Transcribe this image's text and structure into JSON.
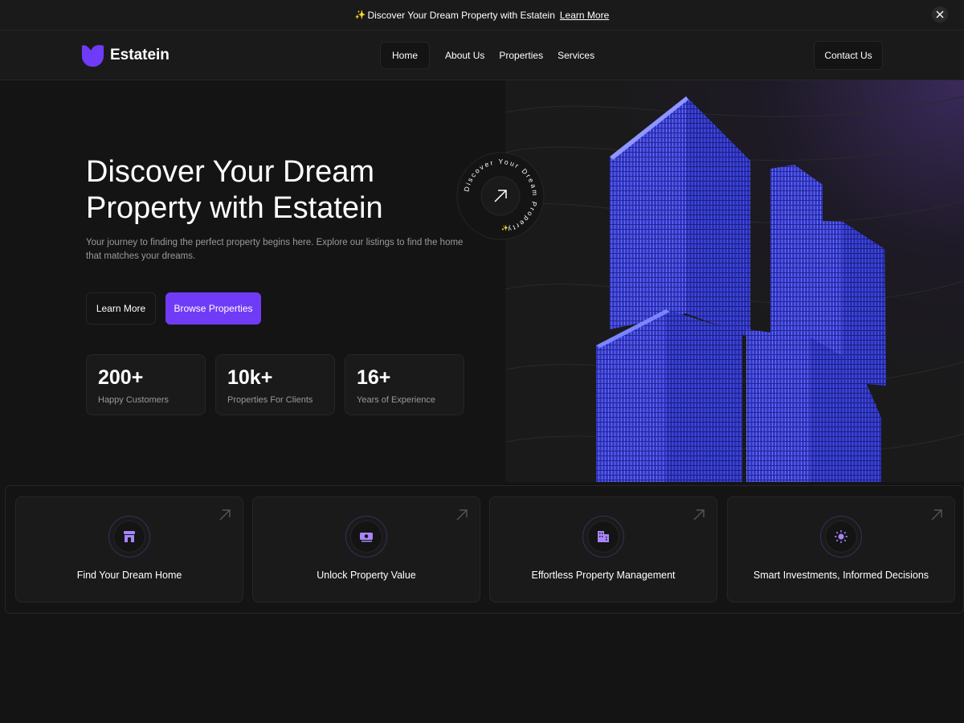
{
  "banner": {
    "text": "Discover Your Dream Property with Estatein",
    "link": "Learn More"
  },
  "nav": {
    "brand": "Estatein",
    "items": [
      {
        "label": "Home",
        "active": true
      },
      {
        "label": "About Us"
      },
      {
        "label": "Properties"
      },
      {
        "label": "Services"
      }
    ],
    "contact": "Contact Us"
  },
  "hero": {
    "title": "Discover Your Dream Property with Estatein",
    "subtitle": "Your journey to finding the perfect property begins here. Explore our listings to find the home that matches your dreams.",
    "learn_more": "Learn More",
    "browse": "Browse Properties",
    "badge_text": "Discover Your Dream Property",
    "stats": [
      {
        "value": "200+",
        "label": "Happy Customers"
      },
      {
        "value": "10k+",
        "label": "Properties For Clients"
      },
      {
        "value": "16+",
        "label": "Years of Experience"
      }
    ]
  },
  "features": [
    {
      "title": "Find Your Dream Home",
      "icon": "storefront-icon"
    },
    {
      "title": "Unlock Property Value",
      "icon": "cash-icon"
    },
    {
      "title": "Effortless Property Management",
      "icon": "buildings-icon"
    },
    {
      "title": "Smart Investments, Informed Decisions",
      "icon": "sun-icon"
    }
  ],
  "colors": {
    "accent": "#703bf7",
    "background": "#141414",
    "surface": "#1a1a1a",
    "border": "#262626",
    "muted_text": "#999999"
  }
}
